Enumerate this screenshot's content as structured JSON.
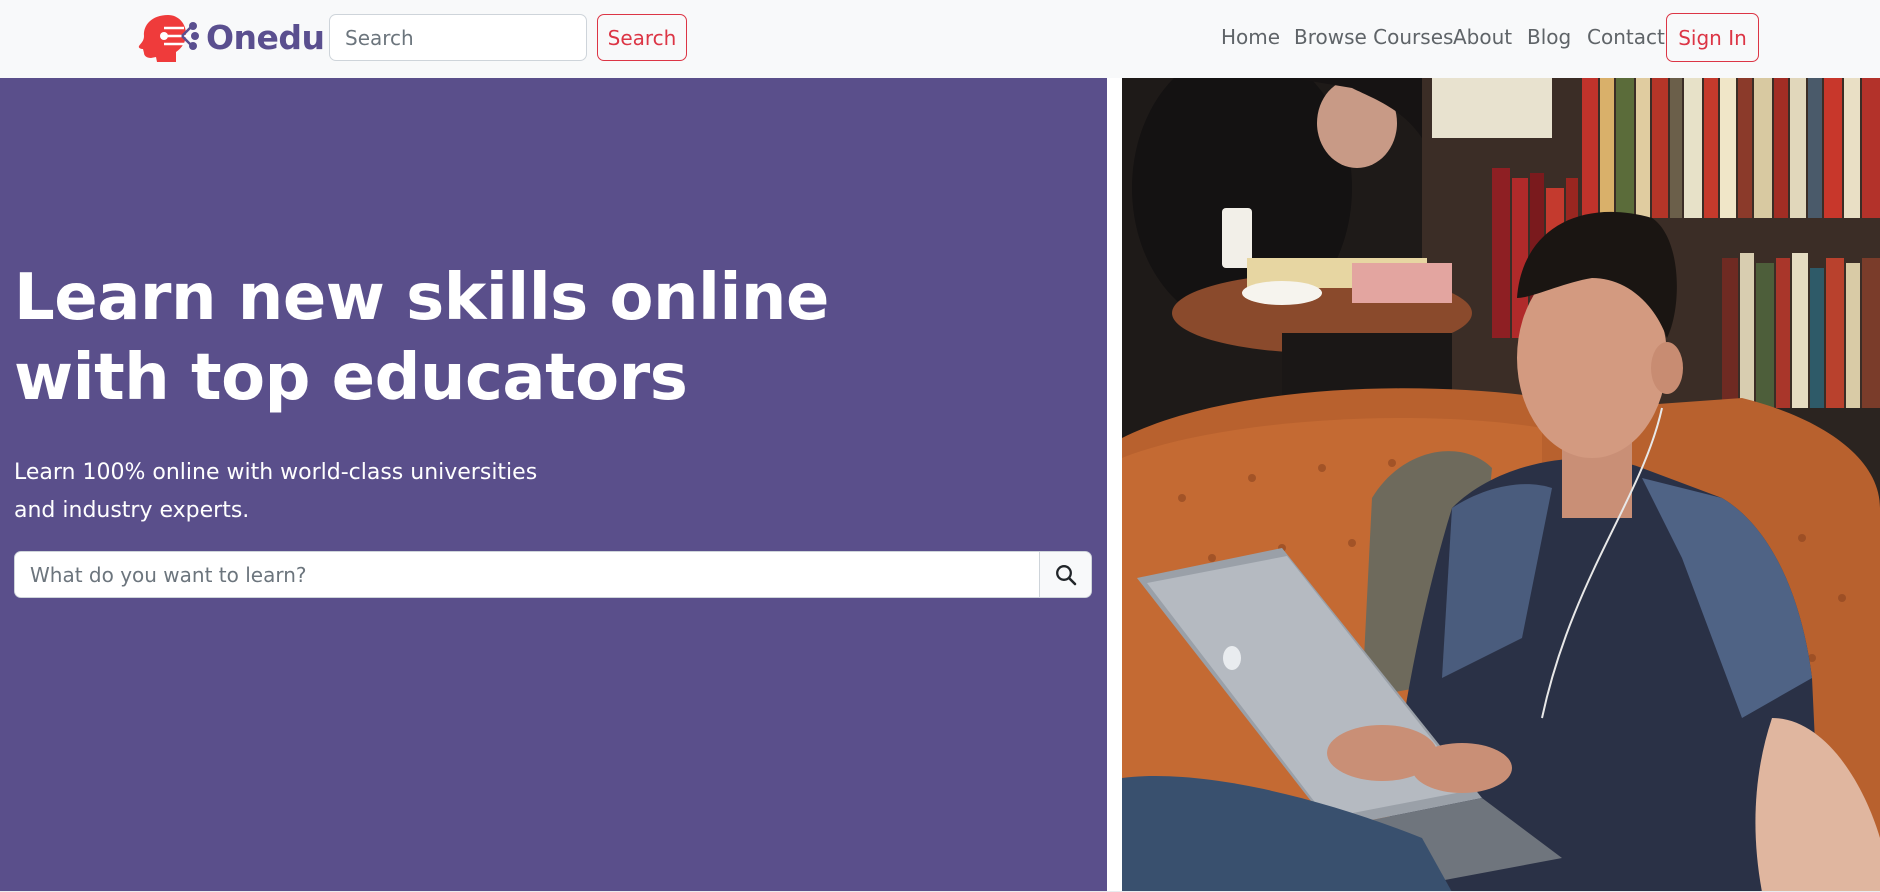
{
  "navbar": {
    "brand": {
      "name": "Onedu",
      "logo_icon": "brain-circuit-icon",
      "logo_color": "#ef3b3b",
      "name_color": "#5a4f8f"
    },
    "search": {
      "placeholder": "Search",
      "button_label": "Search"
    },
    "links": [
      {
        "label": "Home"
      },
      {
        "label": "Browse Courses"
      },
      {
        "label": "About"
      },
      {
        "label": "Blog"
      },
      {
        "label": "Contact"
      }
    ],
    "signin_label": "Sign In",
    "accent_color": "#dc3545"
  },
  "hero": {
    "title_line1": "Learn new skills online",
    "title_line2": "with top educators",
    "subtitle_line1": "Learn 100% online with world-class universities",
    "subtitle_line2": "and industry experts.",
    "search_placeholder": "What do you want to learn?",
    "search_icon": "search-icon",
    "background_color": "#5a4f8b"
  },
  "photo": {
    "icon": "student-with-laptop-photo"
  }
}
